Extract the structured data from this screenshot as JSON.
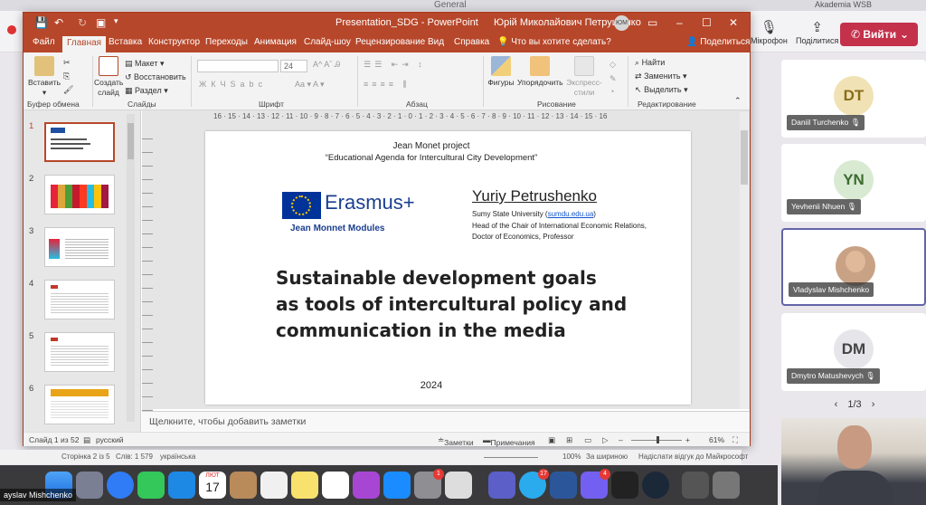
{
  "teams": {
    "window_title": "General",
    "org": "Akademia WSB",
    "user_initials": "YP",
    "mic_label": "Мікрофон",
    "share_label": "Поділитися",
    "leave_label": "Вийти",
    "participants": [
      {
        "initials": "DT",
        "name": "Daniil Turchenko",
        "color": "#f1e2b5",
        "fg": "#8a6d1a"
      },
      {
        "initials": "YN",
        "name": "Yevhenii Nhuen",
        "color": "#d9ead3",
        "fg": "#3d6b2f"
      },
      {
        "initials": "",
        "name": "Vladyslav Mishchenko",
        "color": "#d4b49a",
        "fg": "#333"
      },
      {
        "initials": "DM",
        "name": "Dmytro Matushevych",
        "color": "#e6e6ea",
        "fg": "#444"
      }
    ],
    "page_indicator": "1/3",
    "self_name": "ayslav Mishchenko"
  },
  "ppt": {
    "title": "Presentation_SDG  -  PowerPoint",
    "user": "Юрій Миколайович Петрушенко",
    "user_initials": "ЮМ",
    "tabs": [
      "Файл",
      "Главная",
      "Вставка",
      "Конструктор",
      "Переходы",
      "Анимация",
      "Слайд-шоу",
      "Рецензирование",
      "Вид",
      "Справка",
      "Что вы хотите сделать?"
    ],
    "share": "Поделиться",
    "ribbon": {
      "paste": "Вставить",
      "new_slide": "Создать слайд",
      "layout": "Макет",
      "reset": "Восстановить",
      "section": "Раздел",
      "font_size": "24",
      "shapes": "Фигуры",
      "arrange": "Упорядочить",
      "styles": "Экспресс-стили",
      "find": "Найти",
      "replace": "Заменить",
      "select": "Выделить",
      "groups": [
        "Буфер обмена",
        "Слайды",
        "Шрифт",
        "Абзац",
        "Рисование",
        "Редактирование"
      ]
    },
    "thumbs": [
      "1",
      "2",
      "3",
      "4",
      "5",
      "6"
    ],
    "ruler": "16 · 15 · 14 · 13 · 12 · 11 · 10 · 9 · 8 · 7 · 6 · 5 · 4 · 3 · 2 · 1 · 0 · 1 · 2 · 3 · 4 · 5 · 6 · 7 · 8 · 9 · 10 · 11 · 12 · 13 · 14 · 15 · 16",
    "slide": {
      "project": "Jean Monet project",
      "agenda": "“Educational Agenda for Intercultural City Development”",
      "erasmus": "Erasmus+",
      "jm_modules": "Jean Monnet Modules",
      "author": "Yuriy Petrushenko",
      "aff1_pre": "Sumy State University (",
      "aff1_link": "sumdu.edu.ua",
      "aff1_post": ")",
      "aff2": "Head of the Chair of International Economic Relations,",
      "aff3": "Doctor of Economics, Professor",
      "title1": "Sustainable development goals",
      "title2": "as tools of intercultural policy and",
      "title3": "communication in the media",
      "year": "2024"
    },
    "notes_placeholder": "Щелкните, чтобы добавить заметки",
    "status": {
      "slide": "Слайд 1 из 52",
      "lang": "русский",
      "notes": "Заметки",
      "comments": "Примечания",
      "zoom": "61%"
    }
  },
  "word_status": {
    "page": "Сторінка 2 із 5",
    "words": "Слів: 1 579",
    "lang": "українська",
    "zoom": "100%",
    "fit": "За шириною",
    "feedback": "Надіслати відгук до Майкрософт"
  },
  "dock_badges": {
    "settings": "1",
    "telegram": "17",
    "viber": "4"
  },
  "dock_date": {
    "month": "ЛЮТ",
    "day": "17"
  }
}
